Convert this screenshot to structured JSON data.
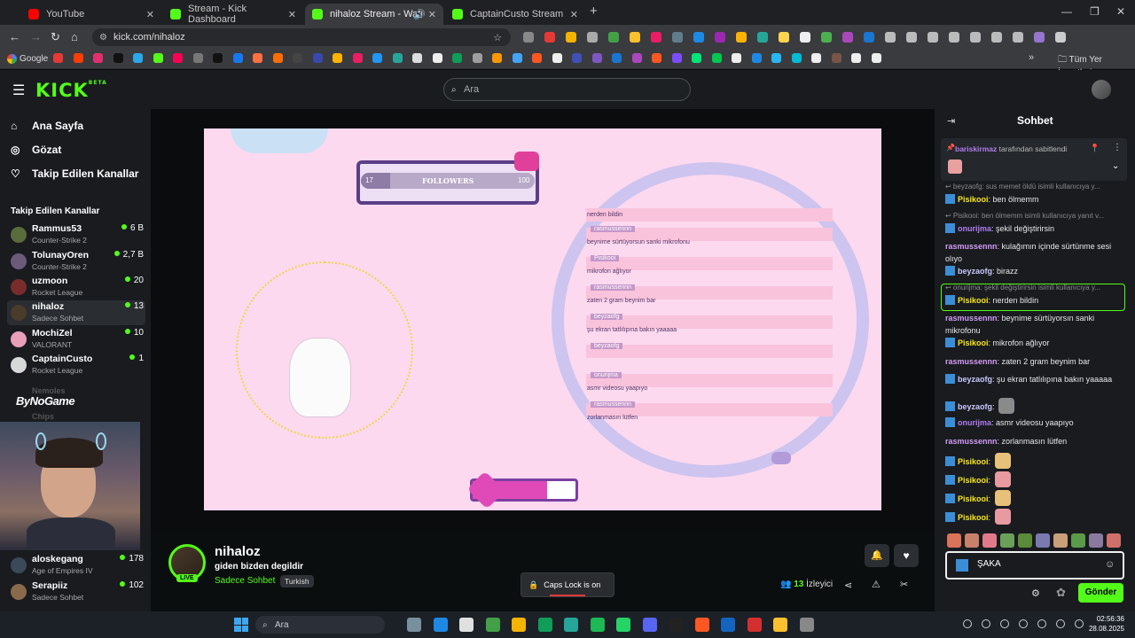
{
  "tabs": [
    {
      "label": "YouTube",
      "color": "#ff0000"
    },
    {
      "label": "Stream - Kick Dashboard",
      "color": "#53fc18"
    },
    {
      "label": "nihaloz Stream - Watch Live",
      "color": "#53fc18"
    },
    {
      "label": "CaptainCusto Stream - Watch L",
      "color": "#53fc18"
    }
  ],
  "url": "kick.com/nihaloz",
  "bookmarks": {
    "first": "Google",
    "all": "Tüm Yer İşaretleri"
  },
  "header": {
    "logo": "KICK",
    "logo_tag": "BETA",
    "search_placeholder": "Ara"
  },
  "sidebar": {
    "nav": [
      "Ana Sayfa",
      "Gözat",
      "Takip Edilen Kanallar"
    ],
    "section": "Takip Edilen Kanallar",
    "channels": [
      {
        "name": "Rammus53",
        "game": "Counter-Strike 2",
        "viewers": "6 B",
        "color": "#5a6b3c"
      },
      {
        "name": "TolunayOren",
        "game": "Counter-Strike 2",
        "viewers": "2,7 B",
        "color": "#6b5a7a"
      },
      {
        "name": "uzmoon",
        "game": "Rocket League",
        "viewers": "20",
        "color": "#7a2b2b"
      },
      {
        "name": "nihaloz",
        "game": "Sadece Sohbet",
        "viewers": "13",
        "color": "#4a3b2b"
      },
      {
        "name": "MochiZel",
        "game": "VALORANT",
        "viewers": "10",
        "color": "#e8a0b8"
      },
      {
        "name": "CaptainCusto",
        "game": "Rocket League",
        "viewers": "1",
        "color": "#d8d8d8"
      }
    ],
    "offline": [
      "Nemoles",
      "Chips"
    ],
    "overlay_brand": "ByNoGame",
    "bottom_channels": [
      {
        "name": "aloskegang",
        "game": "Age of Empires IV",
        "viewers": "178",
        "color": "#3a4a5a"
      },
      {
        "name": "Serapiiz",
        "game": "Sadece Sohbet",
        "viewers": "102",
        "color": "#8a6a4a"
      }
    ]
  },
  "scene": {
    "followers_label": "FOLLOWERS",
    "followers_current": "17",
    "followers_goal": "100",
    "followers_progress": 0.17,
    "heart_bar_fill": 0.72,
    "overlay_chat": [
      {
        "user": "",
        "text": "nerden bildin"
      },
      {
        "user": "rasmussennn",
        "text": "beynime sürtüyorsun sanki mikrofonu"
      },
      {
        "user": "Pisikooi",
        "text": "mikrofon ağlıyor"
      },
      {
        "user": "rasmussennn",
        "text": "zaten 2 gram beynim bar"
      },
      {
        "user": "beyzaofg",
        "text": "şu ekran tatlılıpına bakın yaaaaa"
      },
      {
        "user": "beyzaofg",
        "text": ""
      },
      {
        "user": "onurijma",
        "text": "asmr videosu yaapıyo"
      },
      {
        "user": "rasmussennn",
        "text": "zorlanmasın lütfen"
      }
    ]
  },
  "stream": {
    "name": "nihaloz",
    "title": "giden bizden degildir",
    "category": "Sadece Sohbet",
    "language": "Turkish",
    "live": "LIVE",
    "viewers": "13",
    "viewers_label": "İzleyici",
    "toast": "Caps Lock is on"
  },
  "chat": {
    "title": "Sohbet",
    "pinned_by": "bariskirmaz",
    "pinned_suffix": "tarafından sabitlendi",
    "messages": [
      {
        "reply": "beyzaofg: sus memet öldü isimli kullanıcıya y...",
        "user": "Pisikooi",
        "text": "ben ölmemm",
        "color": "#f8e71c",
        "badge": true
      },
      {
        "reply": "Pisikooi: ben ölmemm isimli kullanıcıya yanıt v...",
        "user": "onurijma",
        "text": "şekil değiştirirsin",
        "color": "#b07cf0",
        "badge": true
      },
      {
        "user": "rasmussennn",
        "text": "kulağımın içinde sürtünme sesi olıyo",
        "color": "#d29cf5",
        "badge": false
      },
      {
        "user": "beyzaofg",
        "text": "birazz",
        "color": "#c9c9ff",
        "badge": true
      },
      {
        "reply": "onurijma: şekil değiştirirsin isimli kullanıcıya y...",
        "user": "Pisikooi",
        "text": "nerden bildin",
        "color": "#f8e71c",
        "badge": true,
        "highlight": true
      },
      {
        "user": "rasmussennn",
        "text": "beynime sürtüyorsın sanki mikrofonu",
        "color": "#d29cf5",
        "badge": false
      },
      {
        "user": "Pisikooi",
        "text": "mikrofon ağlıyor",
        "color": "#f8e71c",
        "badge": true
      },
      {
        "user": "rasmussennn",
        "text": "zaten 2 gram beynim bar",
        "color": "#d29cf5",
        "badge": false
      },
      {
        "user": "beyzaofg",
        "text": "şu ekran tatlılıpına bakın yaaaaa",
        "color": "#c9c9ff",
        "badge": true
      },
      {
        "user": "beyzaofg",
        "text": "",
        "color": "#c9c9ff",
        "badge": true,
        "emote": "#8a8a8a"
      },
      {
        "user": "onurijma",
        "text": "asmr videosu yaapıyo",
        "color": "#b07cf0",
        "badge": true
      },
      {
        "user": "rasmussennn",
        "text": "zorlanmasın lütfen",
        "color": "#d29cf5",
        "badge": false
      },
      {
        "user": "Pisikooi",
        "text": "",
        "color": "#f8e71c",
        "badge": true,
        "emote": "#e8c07a"
      },
      {
        "user": "Pisikooi",
        "text": "",
        "color": "#f8e71c",
        "badge": true,
        "emote": "#e89aa0"
      },
      {
        "user": "Pisikooi",
        "text": "",
        "color": "#f8e71c",
        "badge": true,
        "emote": "#e8c07a"
      },
      {
        "user": "Pisikooi",
        "text": "",
        "color": "#f8e71c",
        "badge": true,
        "emote": "#e89aa0"
      }
    ],
    "input_value": "ŞAKA",
    "send": "Gönder"
  },
  "taskbar": {
    "search": "Ara",
    "time": "02:56:36",
    "date": "28.08.2025"
  },
  "colors": {
    "accent": "#53fc18",
    "chat_bg": "#191b1f",
    "scene_bg": "#fcd9ef"
  }
}
